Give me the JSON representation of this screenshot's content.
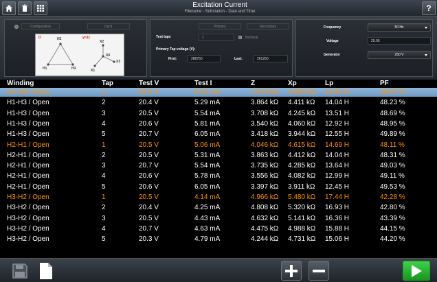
{
  "header": {
    "title": "Excitation Current",
    "subtitle": "Filename - Substation - Date and Time",
    "help_label": "?"
  },
  "config": {
    "configuration_label": "Configuration",
    "dyn_label": "Dyn1",
    "diagram": {
      "delta_label": "D",
      "wye_label": "yn11",
      "delta_terminals": [
        "H2",
        "H1",
        "H3"
      ],
      "wye_terminals": [
        "X2",
        "X0",
        "X3",
        "X1"
      ]
    }
  },
  "taps": {
    "test_taps_label": "Test taps",
    "test_taps_value": "5",
    "primary_label": "Primary",
    "secondary_label": "Secondary",
    "nominal_label": "Nominal",
    "primary_tap_voltage_label": "Primary Tap voltage (V):",
    "first_label": "First:",
    "first_value": "288750",
    "last_label": "Last:",
    "last_value": "261250"
  },
  "source": {
    "frequency_label": "Frequency",
    "frequency_value": "50 Hz",
    "voltage_label": "Voltage",
    "voltage_value": "20.00",
    "generator_label": "Generator",
    "generator_value": "250 V"
  },
  "table": {
    "columns": [
      "Winding",
      "Tap",
      "Test V",
      "Test I",
      "Z",
      "Xp",
      "Lp",
      "PF"
    ],
    "rows": [
      [
        "H1-H3 / Open",
        "1",
        "20.5 V",
        "5.03 mA",
        "4.073 kΩ",
        "4.650 kΩ",
        "14.80 H",
        "48.27 %"
      ],
      [
        "H1-H3 / Open",
        "2",
        "20.4 V",
        "5.29 mA",
        "3.864 kΩ",
        "4.411 kΩ",
        "14.04 H",
        "48.23 %"
      ],
      [
        "H1-H3 / Open",
        "3",
        "20.5 V",
        "5.54 mA",
        "3.708 kΩ",
        "4.245 kΩ",
        "13.51 H",
        "48.69 %"
      ],
      [
        "H1-H3 / Open",
        "4",
        "20.6 V",
        "5.81 mA",
        "3.540 kΩ",
        "4.060 kΩ",
        "12.92 H",
        "48.95 %"
      ],
      [
        "H1-H3 / Open",
        "5",
        "20.7 V",
        "6.05 mA",
        "3.418 kΩ",
        "3.944 kΩ",
        "12.55 H",
        "49.89 %"
      ],
      [
        "H2-H1 / Open",
        "1",
        "20.5 V",
        "5.06 mA",
        "4.046 kΩ",
        "4.615 kΩ",
        "14.69 H",
        "48.11 %"
      ],
      [
        "H2-H1 / Open",
        "2",
        "20.5 V",
        "5.31 mA",
        "3.863 kΩ",
        "4.412 kΩ",
        "14.04 H",
        "48.31 %"
      ],
      [
        "H2-H1 / Open",
        "3",
        "20.7 V",
        "5.54 mA",
        "3.735 kΩ",
        "4.285 kΩ",
        "13.64 H",
        "49.03 %"
      ],
      [
        "H2-H1 / Open",
        "4",
        "20.6 V",
        "5.78 mA",
        "3.556 kΩ",
        "4.082 kΩ",
        "12.99 H",
        "49.11 %"
      ],
      [
        "H2-H1 / Open",
        "5",
        "20.6 V",
        "6.05 mA",
        "3.397 kΩ",
        "3.911 kΩ",
        "12.45 H",
        "49.53 %"
      ],
      [
        "H3-H2 / Open",
        "1",
        "20.5 V",
        "4.14 mA",
        "4.966 kΩ",
        "5.480 kΩ",
        "17.44 H",
        "42.28 %"
      ],
      [
        "H3-H2 / Open",
        "2",
        "20.4 V",
        "4.25 mA",
        "4.808 kΩ",
        "5.320 kΩ",
        "16.93 H",
        "42.80 %"
      ],
      [
        "H3-H2 / Open",
        "3",
        "20.5 V",
        "4.43 mA",
        "4.632 kΩ",
        "5.141 kΩ",
        "16.36 H",
        "43.39 %"
      ],
      [
        "H3-H2 / Open",
        "4",
        "20.7 V",
        "4.63 mA",
        "4.475 kΩ",
        "4.988 kΩ",
        "15.88 H",
        "44.15 %"
      ],
      [
        "H3-H2 / Open",
        "5",
        "20.3 V",
        "4.79 mA",
        "4.244 kΩ",
        "4.731 kΩ",
        "15.06 H",
        "44.20 %"
      ]
    ]
  },
  "colors": {
    "accent_orange": "#ff9000",
    "selected_row": "#7ea8d2",
    "run_green": "#2fb83a"
  }
}
